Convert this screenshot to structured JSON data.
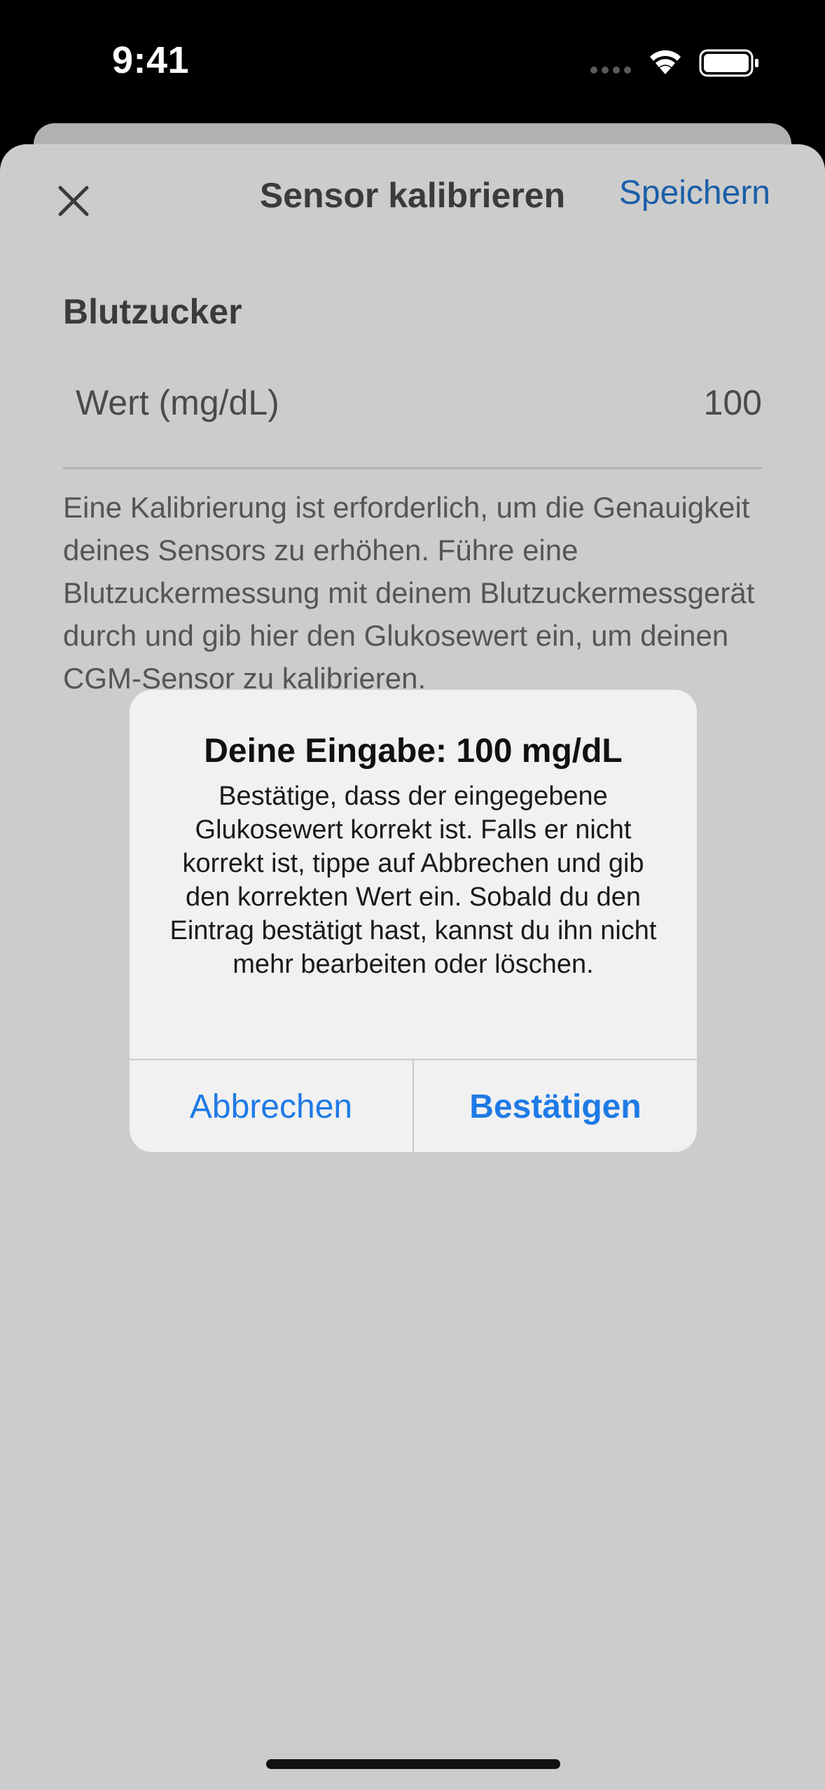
{
  "status_bar": {
    "time": "9:41",
    "icons": [
      "signal-dots-icon",
      "wifi-icon",
      "battery-icon"
    ]
  },
  "sheet": {
    "close_icon": "close-icon",
    "title": "Sensor kalibrieren",
    "save_label": "Speichern",
    "section_title": "Blutzucker",
    "value_label": "Wert (mg/dL)",
    "value": "100",
    "description": "Eine Kalibrierung ist erforderlich, um die Genauigkeit deines Sensors zu erhöhen. Führe eine Blutzuckermessung mit deinem Blutzuckermessgerät durch und gib hier den Glukosewert ein, um deinen CGM-Sensor zu kalibrieren."
  },
  "alert": {
    "title": "Deine Eingabe: 100 mg/dL",
    "message": "Bestätige, dass der eingegebene Glukosewert korrekt ist. Falls er nicht korrekt ist, tippe auf Abbrechen und gib den korrekten Wert ein. Sobald du den Eintrag bestätigt hast, kannst du ihn nicht mehr bearbeiten oder löschen.",
    "cancel_label": "Abbrechen",
    "confirm_label": "Bestätigen"
  },
  "colors": {
    "accent": "#1e7ae6",
    "dimmed_accent": "#1a5ea8",
    "overlay_background": "#cccccc"
  }
}
